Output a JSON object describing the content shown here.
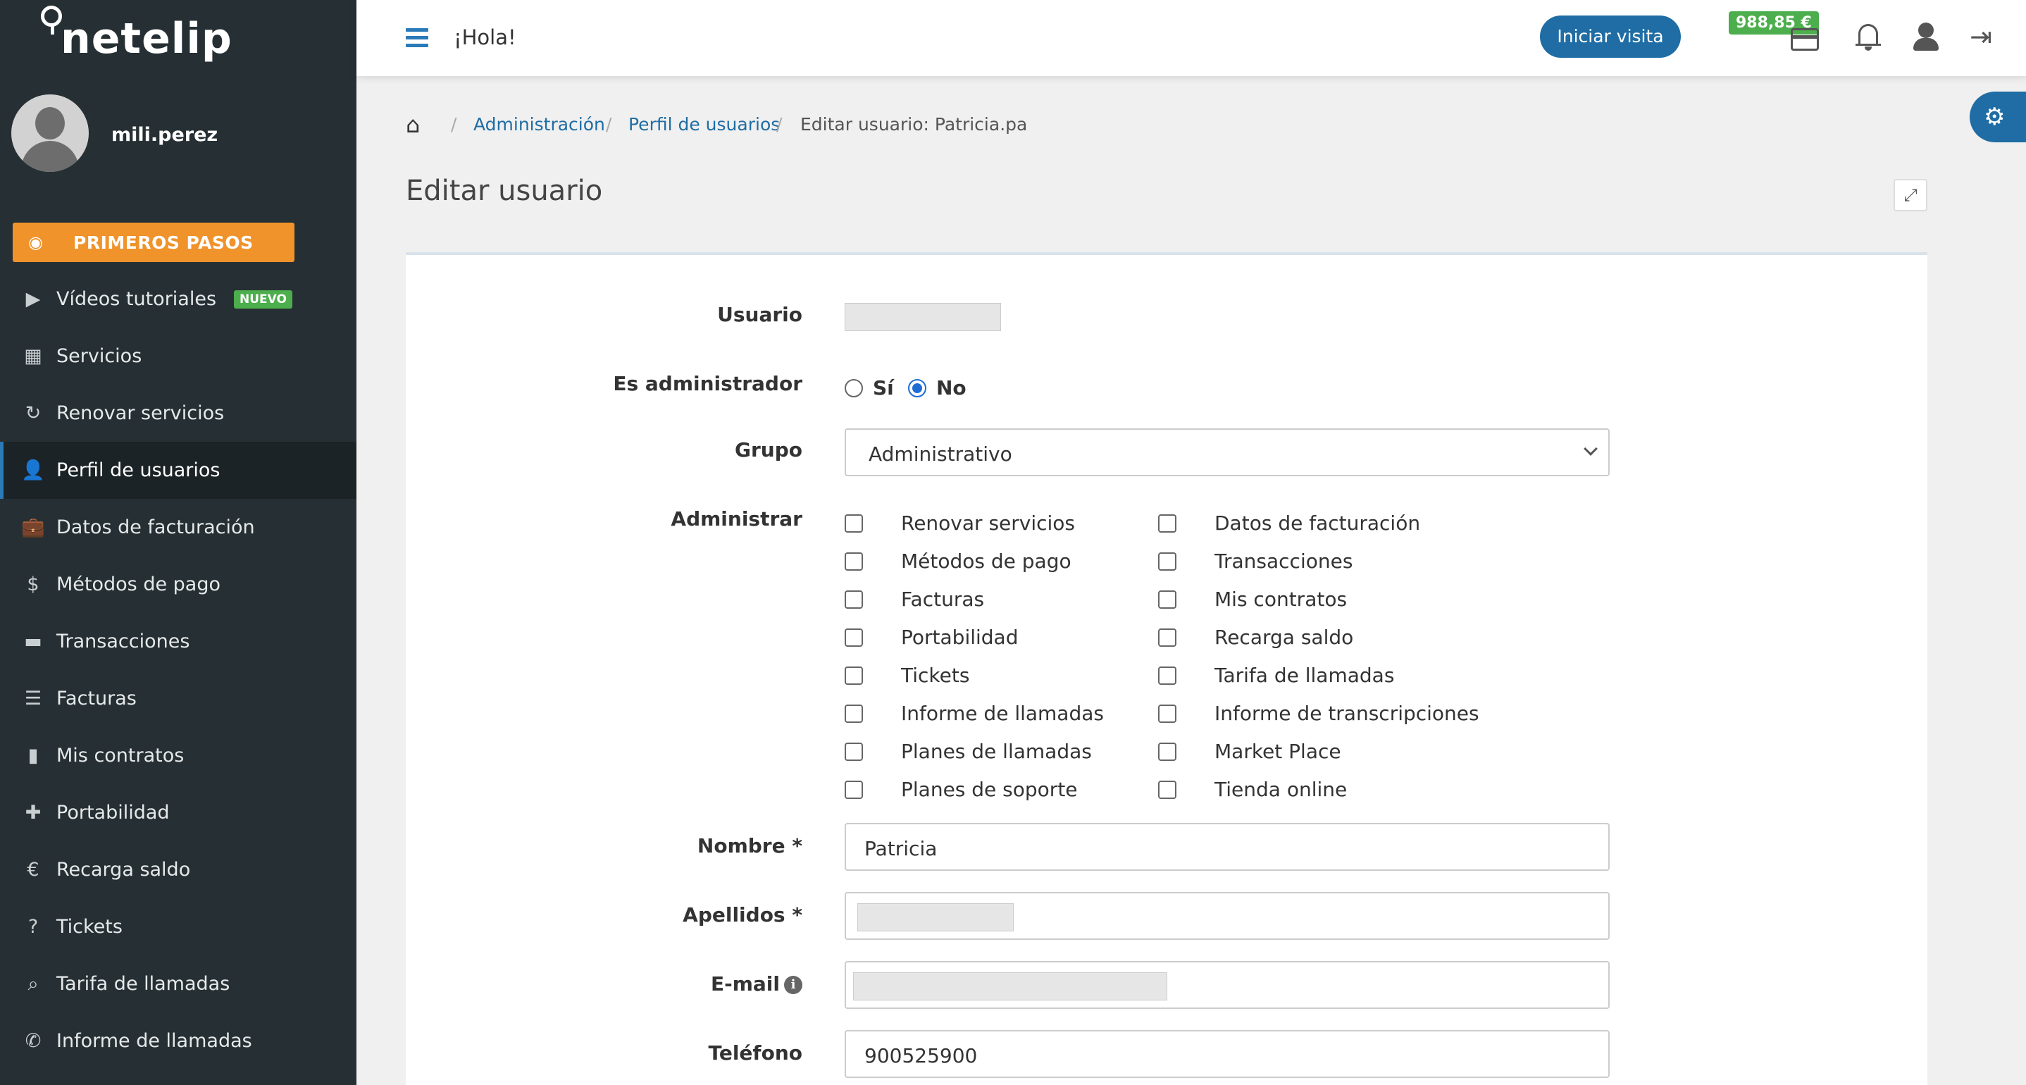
{
  "app": {
    "logo_text": "netelip"
  },
  "user": {
    "name": "mili.perez"
  },
  "sidebar": {
    "first_steps": "PRIMEROS PASOS",
    "items": [
      {
        "label": "Vídeos tutoriales",
        "icon": "video-icon",
        "glyph": "▶",
        "badge": "NUEVO"
      },
      {
        "label": "Servicios",
        "icon": "grid-icon",
        "glyph": "▦"
      },
      {
        "label": "Renovar servicios",
        "icon": "refresh-icon",
        "glyph": "↻"
      },
      {
        "label": "Perfil de usuarios",
        "icon": "user-icon",
        "glyph": "👤",
        "active": true
      },
      {
        "label": "Datos de facturación",
        "icon": "briefcase-icon",
        "glyph": "💼"
      },
      {
        "label": "Métodos de pago",
        "icon": "dollar-icon",
        "glyph": "$"
      },
      {
        "label": "Transacciones",
        "icon": "credit-card-icon",
        "glyph": "▬"
      },
      {
        "label": "Facturas",
        "icon": "list-icon",
        "glyph": "☰"
      },
      {
        "label": "Mis contratos",
        "icon": "file-icon",
        "glyph": "▮"
      },
      {
        "label": "Portabilidad",
        "icon": "plus-icon",
        "glyph": "✚"
      },
      {
        "label": "Recarga saldo",
        "icon": "euro-icon",
        "glyph": "€"
      },
      {
        "label": "Tickets",
        "icon": "question-icon",
        "glyph": "?"
      },
      {
        "label": "Tarifa de llamadas",
        "icon": "search-icon",
        "glyph": "⌕"
      },
      {
        "label": "Informe de llamadas",
        "icon": "phone-icon",
        "glyph": "✆"
      }
    ]
  },
  "topbar": {
    "greeting": "¡Hola!",
    "visit_button": "Iniciar visita",
    "balance": "988,85 €"
  },
  "breadcrumb": {
    "items": [
      "Administración",
      "Perfil de usuarios"
    ],
    "current": "Editar usuario: Patricia.pa"
  },
  "page": {
    "title": "Editar usuario"
  },
  "form": {
    "usuario_label": "Usuario",
    "admin_label": "Es administrador",
    "admin_options": [
      "Sí",
      "No"
    ],
    "admin_selected": "No",
    "grupo_label": "Grupo",
    "grupo_value": "Administrativo",
    "administrar_label": "Administrar",
    "permissions_left": [
      "Renovar servicios",
      "Métodos de pago",
      "Facturas",
      "Portabilidad",
      "Tickets",
      "Informe de llamadas",
      "Planes de llamadas",
      "Planes de soporte"
    ],
    "permissions_right": [
      "Datos de facturación",
      "Transacciones",
      "Mis contratos",
      "Recarga saldo",
      "Tarifa de llamadas",
      "Informe de transcripciones",
      "Market Place",
      "Tienda online"
    ],
    "nombre_label": "Nombre *",
    "nombre_value": "Patricia",
    "apellidos_label": "Apellidos *",
    "email_label": "E-mail",
    "telefono_label": "Teléfono",
    "telefono_value": "900525900"
  }
}
